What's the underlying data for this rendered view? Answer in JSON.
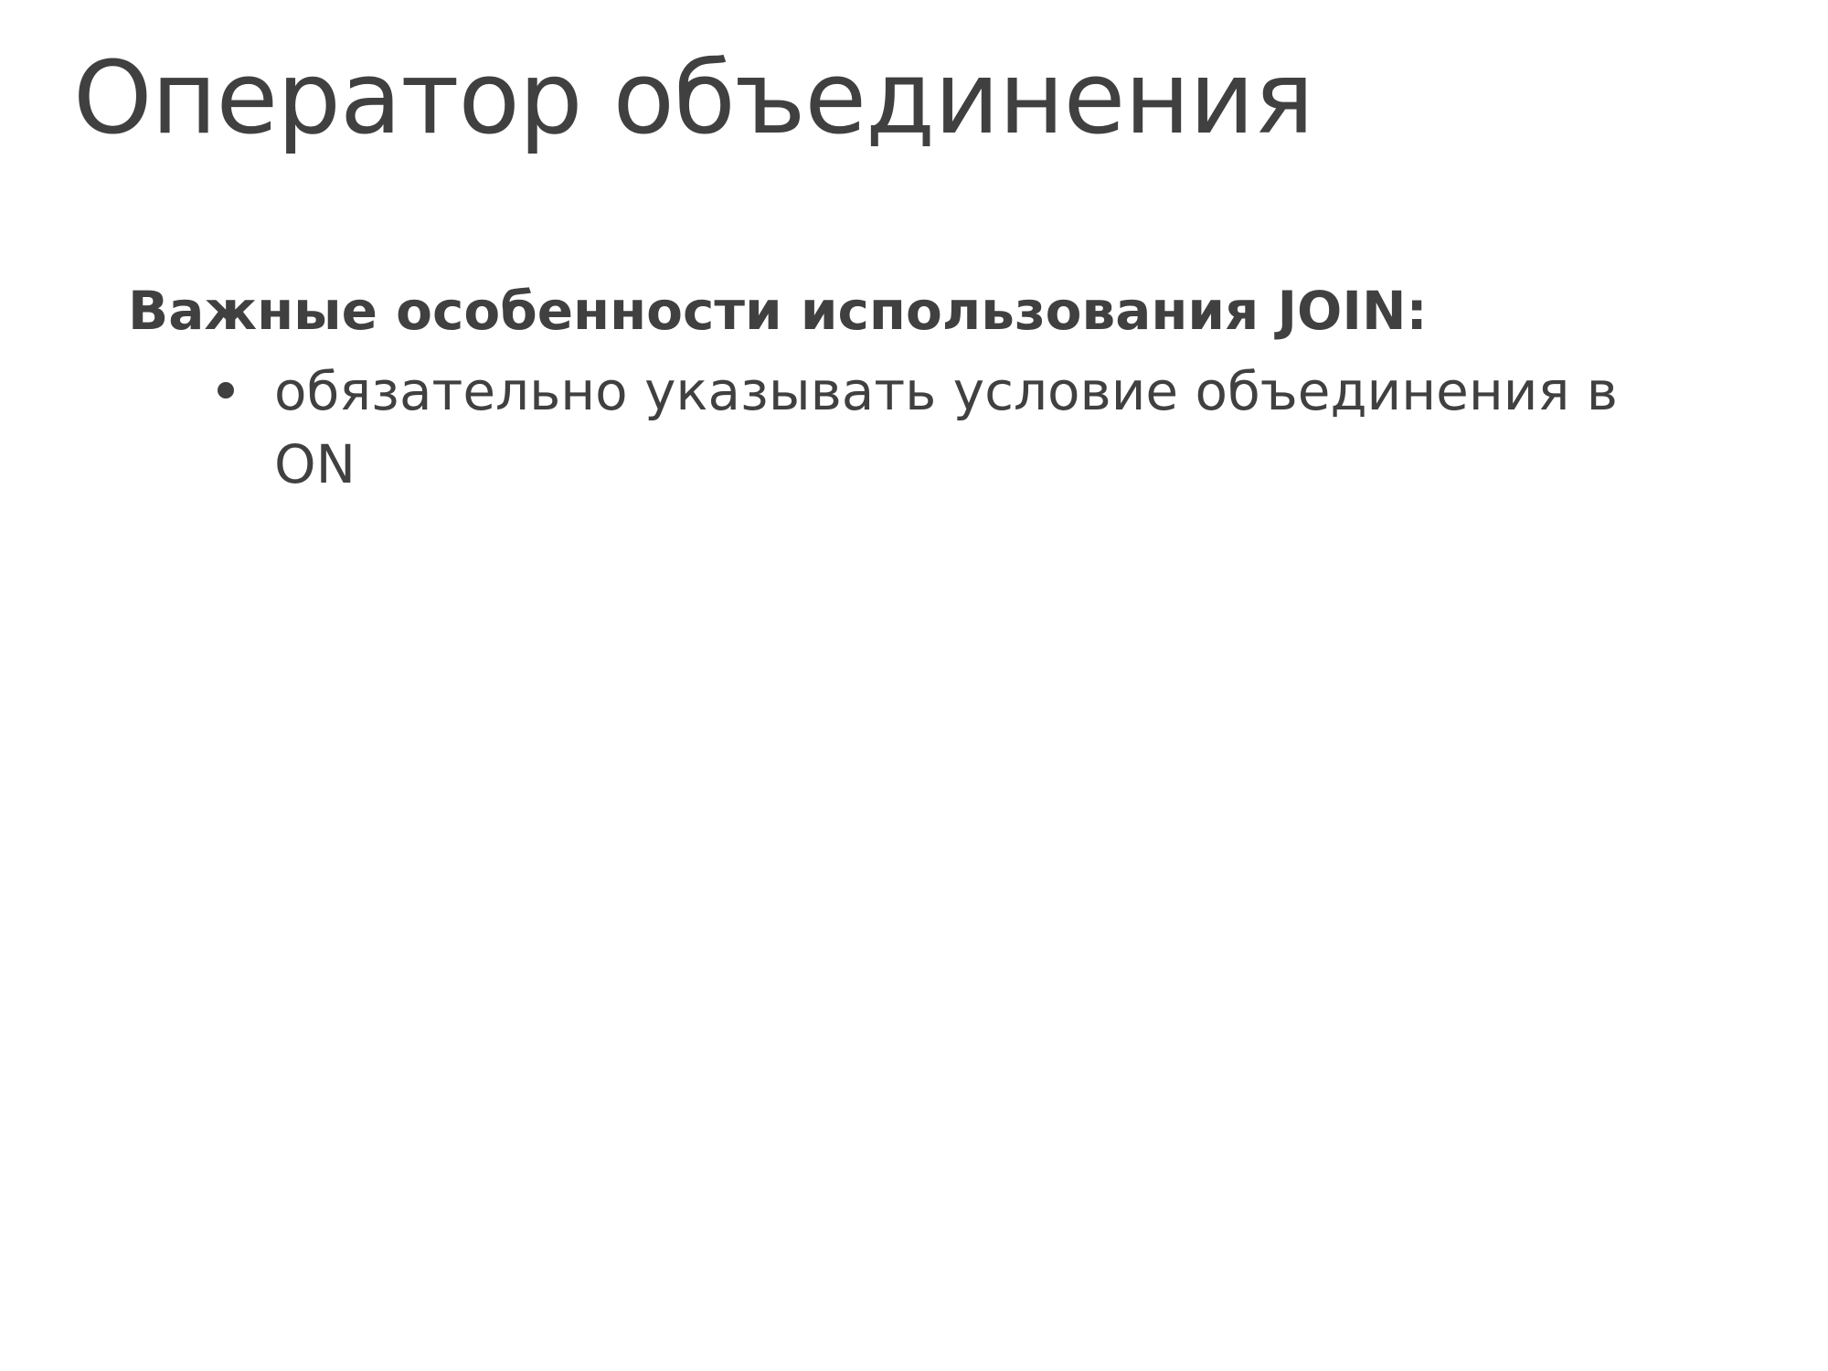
{
  "slide": {
    "title": "Оператор объединения",
    "lead": "Важные особенности использования JOIN:",
    "bullets": [
      {
        "text": "обязательно указывать условие объединения в ON"
      }
    ]
  },
  "colors": {
    "text": "#404040",
    "background": "#ffffff"
  },
  "icons": {
    "bullet": "bullet-dot-icon"
  }
}
